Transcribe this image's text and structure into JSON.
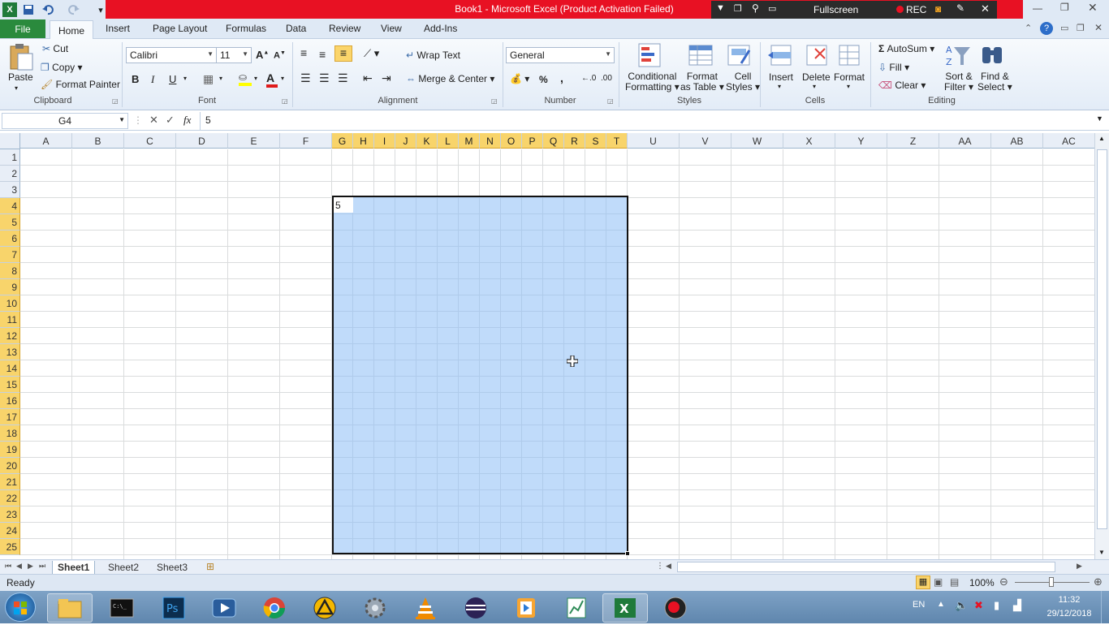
{
  "window": {
    "title": "Book1  -  Microsoft Excel (Product Activation Failed)",
    "recorder": {
      "fullscreen_label": "Fullscreen",
      "rec_label": "REC"
    }
  },
  "ribbon": {
    "file_tab": "File",
    "tabs": [
      "Home",
      "Insert",
      "Page Layout",
      "Formulas",
      "Data",
      "Review",
      "View",
      "Add-Ins"
    ],
    "clipboard": {
      "paste": "Paste",
      "cut": "Cut",
      "copy": "Copy",
      "format_painter": "Format Painter",
      "group": "Clipboard"
    },
    "font": {
      "name": "Calibri",
      "size": "11",
      "bold": "B",
      "italic": "I",
      "underline": "U",
      "group": "Font"
    },
    "alignment": {
      "wrap_text": "Wrap Text",
      "merge_center": "Merge & Center",
      "group": "Alignment"
    },
    "number": {
      "format": "General",
      "percent": "%",
      "comma": ",",
      "group": "Number"
    },
    "styles": {
      "conditional_1": "Conditional",
      "conditional_2": "Formatting",
      "format_table_1": "Format",
      "format_table_2": "as Table",
      "cell_styles_1": "Cell",
      "cell_styles_2": "Styles",
      "group": "Styles"
    },
    "cells": {
      "insert": "Insert",
      "delete": "Delete",
      "format": "Format",
      "group": "Cells"
    },
    "editing": {
      "autosum": "AutoSum",
      "fill": "Fill",
      "clear": "Clear",
      "sort_1": "Sort &",
      "sort_2": "Filter",
      "find_1": "Find &",
      "find_2": "Select",
      "group": "Editing"
    }
  },
  "formula_bar": {
    "name_box": "G4",
    "fx": "fx",
    "content": "5"
  },
  "grid": {
    "columns": [
      "A",
      "B",
      "C",
      "D",
      "E",
      "F",
      "G",
      "H",
      "I",
      "J",
      "K",
      "L",
      "M",
      "N",
      "O",
      "P",
      "Q",
      "R",
      "S",
      "T",
      "U",
      "V",
      "W",
      "X",
      "Y",
      "Z",
      "AA",
      "AB",
      "AC"
    ],
    "rows": [
      "1",
      "2",
      "3",
      "4",
      "5",
      "6",
      "7",
      "8",
      "9",
      "10",
      "11",
      "12",
      "13",
      "14",
      "15",
      "16",
      "17",
      "18",
      "19",
      "20",
      "21",
      "22",
      "23",
      "24",
      "25"
    ],
    "active_cell_value": "5"
  },
  "sheets": [
    "Sheet1",
    "Sheet2",
    "Sheet3"
  ],
  "status": {
    "ready": "Ready",
    "zoom": "100%"
  },
  "taskbar": {
    "lang": "EN",
    "time": "11:32",
    "date": "29/12/2018"
  }
}
